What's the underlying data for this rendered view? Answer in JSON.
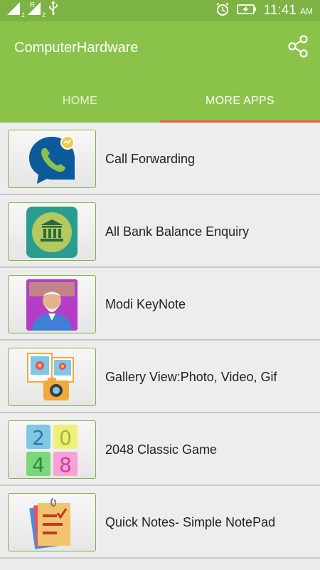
{
  "status": {
    "time": "11:41",
    "ampm": "AM",
    "network_label": "R",
    "sim1": "1",
    "sim2": "2"
  },
  "app": {
    "title": "ComputerHardware"
  },
  "tabs": [
    {
      "label": "HOME",
      "active": false
    },
    {
      "label": "MORE APPS",
      "active": true
    }
  ],
  "apps": [
    {
      "label": "Call Forwarding",
      "icon": "phone-bubble-icon"
    },
    {
      "label": "All Bank Balance Enquiry",
      "icon": "bank-icon"
    },
    {
      "label": "Modi KeyNote",
      "icon": "person-portrait-icon"
    },
    {
      "label": "Gallery View:Photo, Video, Gif",
      "icon": "gallery-camera-icon"
    },
    {
      "label": "2048 Classic Game",
      "icon": "number-tiles-icon"
    },
    {
      "label": "Quick Notes- Simple NotePad",
      "icon": "notepad-icon"
    }
  ],
  "tile_numbers": [
    "2",
    "0",
    "4",
    "8"
  ],
  "colors": {
    "primary": "#8bc34a",
    "status_bar": "#7cb342",
    "tab_indicator": "#ef5350"
  }
}
